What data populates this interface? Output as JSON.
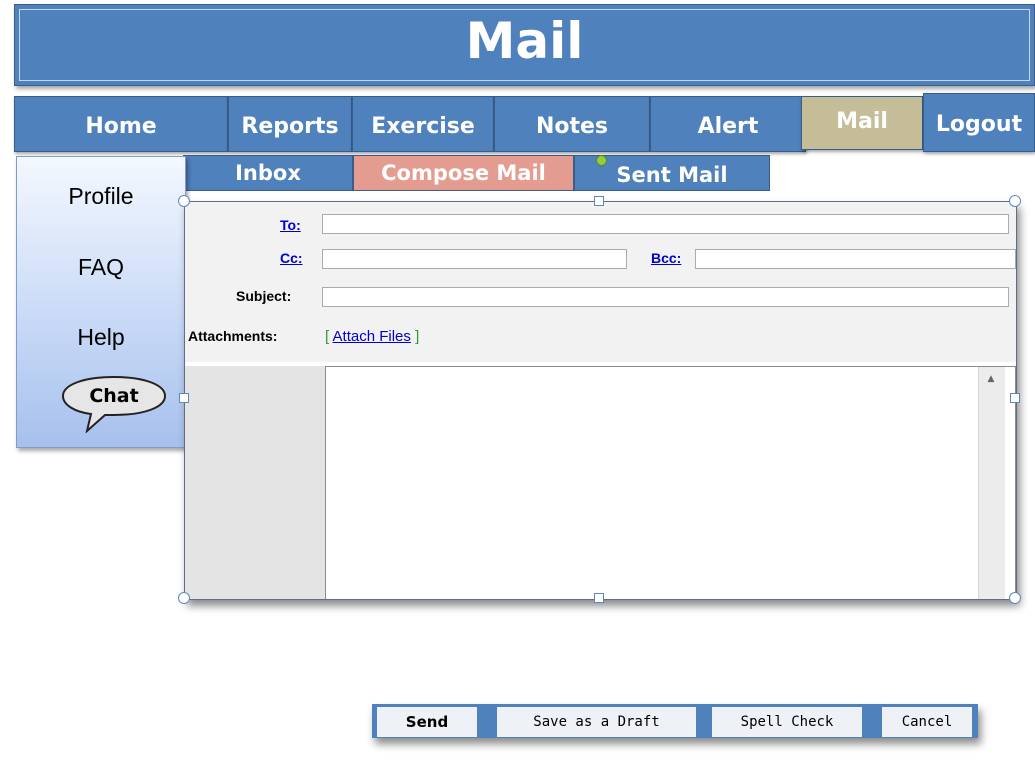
{
  "header": {
    "title": "Mail"
  },
  "nav": {
    "tabs": [
      {
        "label": "Home"
      },
      {
        "label": "Reports"
      },
      {
        "label": "Exercise"
      },
      {
        "label": "Notes"
      },
      {
        "label": "Alert"
      },
      {
        "label": "Mail",
        "active": true
      },
      {
        "label": "Logout"
      }
    ]
  },
  "subnav": {
    "tabs": [
      {
        "label": "Inbox"
      },
      {
        "label": "Compose Mail",
        "active": true
      },
      {
        "label": "Sent Mail"
      }
    ]
  },
  "sidebar": {
    "items": [
      {
        "label": "Profile"
      },
      {
        "label": "FAQ"
      },
      {
        "label": "Help"
      }
    ],
    "chat": {
      "label": "Chat"
    }
  },
  "compose": {
    "to_label": "To:",
    "to_value": "",
    "cc_label": "Cc:",
    "cc_value": "",
    "bcc_label": "Bcc:",
    "bcc_value": "",
    "subject_label": "Subject:",
    "subject_value": "",
    "attachments_label": "Attachments:",
    "attach_open": "[",
    "attach_link": "Attach Files",
    "attach_close": "]",
    "body_value": ""
  },
  "actions": {
    "send": "Send",
    "draft": "Save as a Draft",
    "spell": "Spell Check",
    "cancel": "Cancel"
  },
  "colors": {
    "brand_blue": "#4f81bd",
    "active_tab": "#c4bd97",
    "active_subtab": "#e39c8f"
  }
}
